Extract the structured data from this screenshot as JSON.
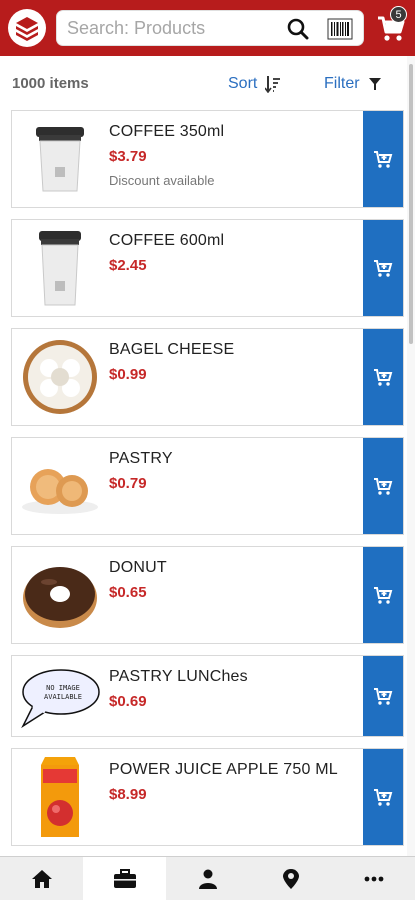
{
  "header": {
    "search_placeholder": "Search: Products",
    "cart_badge": "5",
    "brand_color": "#b71c1c"
  },
  "toolbar": {
    "item_count": "1000 items",
    "sort_label": "Sort",
    "filter_label": "Filter"
  },
  "products": [
    {
      "name": "COFFEE 350ml",
      "price": "$3.79",
      "note": "Discount available",
      "image": "coffee-cup-small"
    },
    {
      "name": "COFFEE 600ml",
      "price": "$2.45",
      "note": "",
      "image": "coffee-cup-large"
    },
    {
      "name": "BAGEL CHEESE",
      "price": "$0.99",
      "note": "",
      "image": "bagel"
    },
    {
      "name": "PASTRY",
      "price": "$0.79",
      "note": "",
      "image": "pastry"
    },
    {
      "name": "DONUT",
      "price": "$0.65",
      "note": "",
      "image": "donut"
    },
    {
      "name": "PASTRY LUNChes",
      "price": "$0.69",
      "note": "",
      "image": "no-image-bubble"
    },
    {
      "name": "POWER JUICE APPLE 750 ML",
      "price": "$8.99",
      "note": "",
      "image": "juice-carton"
    }
  ],
  "no_image_text": "NO IMAGE AVAILABLE",
  "colors": {
    "accent": "#1f6fc1",
    "price": "#c62828",
    "link": "#2b6fc0"
  },
  "bottom_nav": [
    {
      "icon": "home-icon",
      "active": false
    },
    {
      "icon": "briefcase-icon",
      "active": true
    },
    {
      "icon": "person-icon",
      "active": false
    },
    {
      "icon": "location-pin-icon",
      "active": false
    },
    {
      "icon": "more-icon",
      "active": false
    }
  ]
}
